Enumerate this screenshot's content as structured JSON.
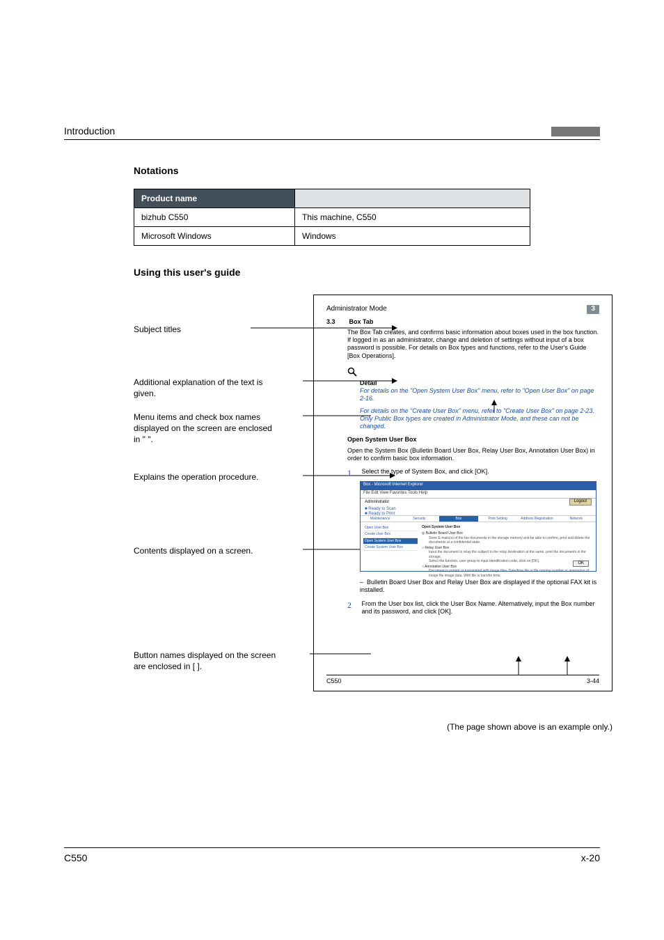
{
  "header": {
    "title": "Introduction"
  },
  "sections": {
    "notations": "Notations",
    "using_guide": "Using this user's guide"
  },
  "table": {
    "header_product": "Product name",
    "rows": [
      {
        "name": "bizhub C550",
        "alias": "This machine, C550"
      },
      {
        "name": "Microsoft Windows",
        "alias": "Windows"
      }
    ]
  },
  "callouts": {
    "subject": "Subject titles",
    "additional": "Additional explanation of the text is given.",
    "menu": "Menu items and check box names displayed on the screen are enclosed in \" \".",
    "explains": "Explains the operation procedure.",
    "contents": "Contents displayed on a screen.",
    "buttons": "Button names displayed on the screen are enclosed in [ ]."
  },
  "capture": {
    "mode": "Administrator Mode",
    "chapnum": "3",
    "secnum": "3.3",
    "sectitle": "Box Tab",
    "para": "The Box Tab creates, and confirms basic information about boxes used in the box function. If logged in as an administrator, change and deletion of settings without input of a box password is possible. For details on Box types and functions, refer to the User's Guide [Box Operations].",
    "detail_h": "Detail",
    "detail_i1": "For details on the \"Open System User Box\" menu, refer to \"Open User Box\" on page 2-16.",
    "detail_i2": "For details on the \"Create User Box\" menu, refer to \"Create User Box\" on page 2-23. Only Public Box types are created in Administrator Mode, and these can not be changed.",
    "sub_h": "Open System User Box",
    "sub_p": "Open the System Box (Bulletin Board User Box, Relay User Box, Annotation User Box) in order to confirm basic box information.",
    "step1": "Select the type of System Box, and click [OK].",
    "dash": "Bulletin Board User Box and Relay User Box are displayed if the optional FAX kit is installed.",
    "step2": "From the User box list, click the User Box Name. Alternatively, input the Box number and its password, and click [OK].",
    "footer_left": "C550",
    "footer_right": "3-44",
    "screenshot": {
      "titlebar": "Box - Microsoft Internet Explorer",
      "menubar": "File    Edit    View    Favorites    Tools    Help",
      "admin": "Administrator",
      "ready_scan": "Ready to Scan",
      "ready_print": "Ready to Print",
      "logout": "Logout",
      "tabs": {
        "maintenance": "Maintenance",
        "security": "Security",
        "box": "Box",
        "print": "Print Setting",
        "address": "Address Registration",
        "network": "Network"
      },
      "side": {
        "open_user": "Open User Box",
        "create_user": "Create User Box",
        "open_system": "Open System User Box",
        "create_system": "Create System User Box"
      },
      "main": {
        "heading": "Open System User Box",
        "opt1": "Bulletin Board User Box",
        "opt1_desc": "Store E-mails(s) of the fax documents in the storage memory and be able to confirm, print and delete the documents at a confidential state.",
        "opt2": "Relay User Box",
        "opt2_desc": "Input the document to relay the subject to the relay destination at the same, print the documents in the storage.",
        "opt2_desc2": "Select the function, user group to input identification code, click on [OK].",
        "opt3": "Annotation User Box",
        "opt3_desc": "Document is printed or transmitted with image files. Date/time file or file running number or annotation of image file image data. With file is transfer time."
      },
      "ok": "OK"
    }
  },
  "example_note": "(The page shown above is an example only.)",
  "footer": {
    "left": "C550",
    "right": "x-20"
  }
}
